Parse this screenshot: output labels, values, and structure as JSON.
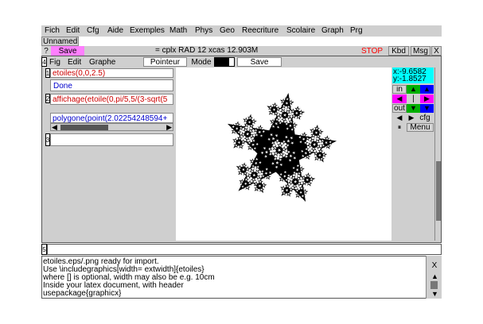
{
  "menubar": {
    "items": [
      "Fich",
      "Edit",
      "Cfg",
      "Aide",
      "Exemples",
      "Math",
      "Phys",
      "Geo",
      "Reecriture",
      "Scolaire",
      "Graph",
      "Prg"
    ]
  },
  "tab": {
    "label": "Unnamed"
  },
  "toolbar": {
    "help_label": "?",
    "save_label": "Save",
    "status_text": "= cplx RAD 12 xcas 12.903M",
    "stop_label": "STOP",
    "kbd_label": "Kbd",
    "msg_label": "Msg",
    "close_label": "X"
  },
  "session": {
    "menu": [
      "Fig",
      "Edit",
      "Graphe"
    ],
    "mode_label": "Pointeur",
    "mode2_label": "Mode",
    "save_label": "Save",
    "entries": [
      {
        "num": "1",
        "input": "etoiles(0,0,2.5)",
        "output": "Done"
      },
      {
        "num": "2",
        "input": "affichage(etoile(0,pi/5,5/(3-sqrt(5",
        "output": "polygone(point(2.02254248594+"
      },
      {
        "num": "3",
        "input": "",
        "output": ""
      }
    ],
    "next_line_num": "5"
  },
  "graph_panel": {
    "coord_x": "x:-9.6582",
    "coord_y": "y:-1.8527",
    "in_label": "in",
    "out_label": "out",
    "cfg_label": "cfg",
    "menu_label": "Menu",
    "colors": {
      "coord_bg": "#00ffff",
      "green": "#00b000",
      "blue": "#0000ff",
      "magenta": "#ff00ff"
    }
  },
  "console": {
    "lines": [
      "etoiles.eps/.png ready for import.",
      "Use \\includegraphics[width=    extwidth]{etoiles}",
      "where [] is optional, width may also be e.g. 10cm",
      "Inside your latex document, with header",
      "usepackage{graphicx}"
    ],
    "close_label": "X"
  },
  "colors": {
    "panel": "#cfcfcf",
    "stop": "#ff0000",
    "save_pink": "#ff7fff",
    "input_red": "#cc0000",
    "output_blue": "#0000cc"
  }
}
